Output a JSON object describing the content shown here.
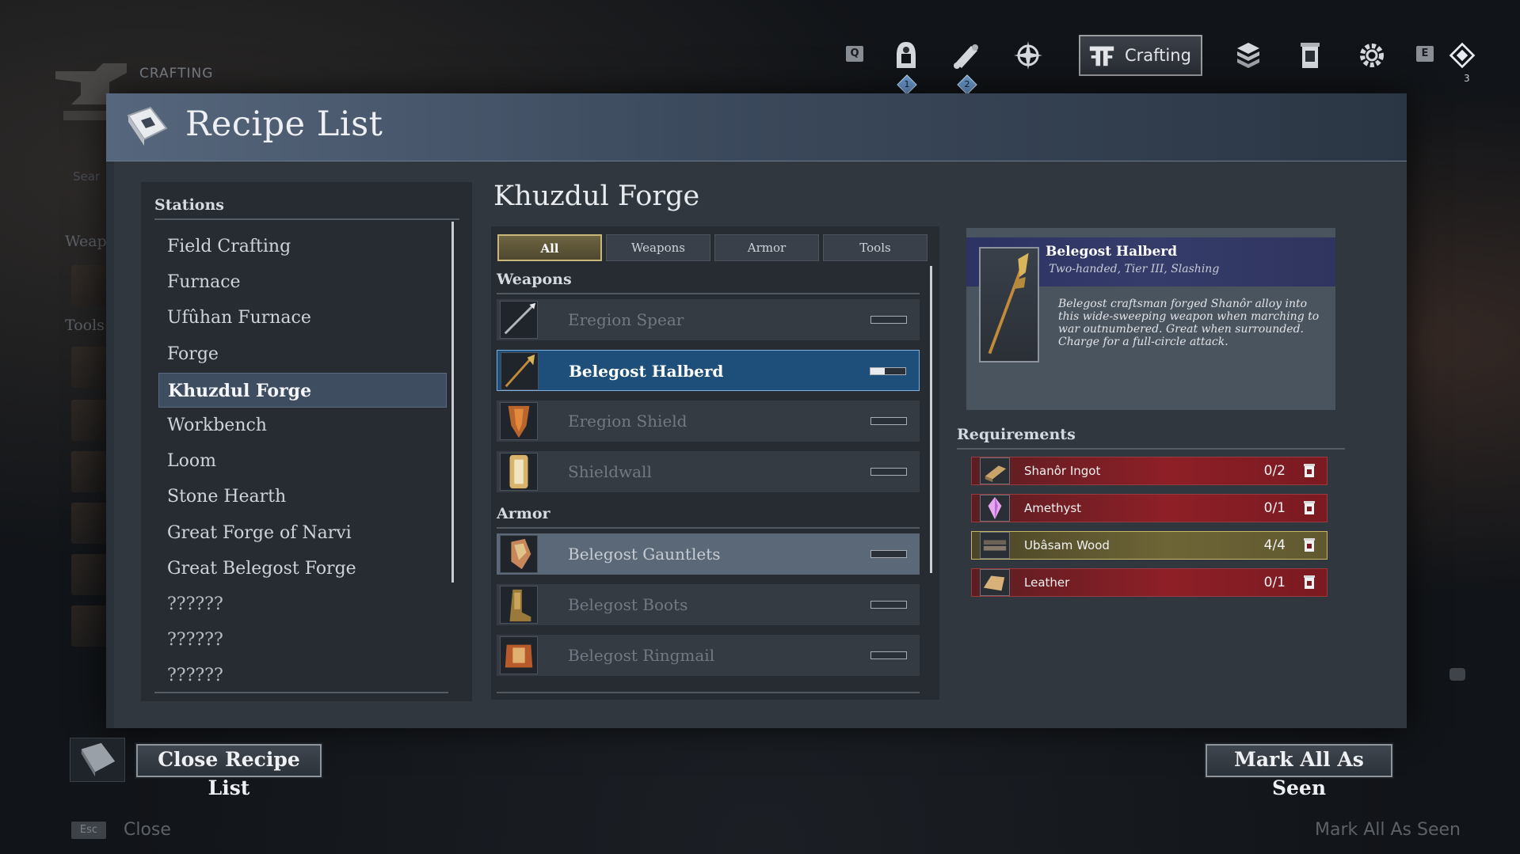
{
  "background": {
    "section_label": "CRAFTING",
    "ghost_list": [
      "Weap",
      "Tools"
    ],
    "ghost_search": "Sear"
  },
  "topbar": {
    "left_key": "Q",
    "right_key": "E",
    "badge_1": "1",
    "badge_2": "2",
    "counter": "3",
    "crafting_label": "Crafting",
    "icons": [
      "character-icon",
      "scroll-icon",
      "compass-icon",
      "crafting-icon",
      "blocks-icon",
      "lantern-icon",
      "gear-icon",
      "waypoint-icon"
    ]
  },
  "panel": {
    "title": "Recipe List"
  },
  "stations": {
    "title": "Stations",
    "items": [
      {
        "label": "Field Crafting",
        "state": "normal"
      },
      {
        "label": "Furnace",
        "state": "normal"
      },
      {
        "label": "Ufûhan Furnace",
        "state": "normal"
      },
      {
        "label": "Forge",
        "state": "normal"
      },
      {
        "label": "Khuzdul Forge",
        "state": "active"
      },
      {
        "label": "Workbench",
        "state": "normal"
      },
      {
        "label": "Loom",
        "state": "normal"
      },
      {
        "label": "Stone Hearth",
        "state": "normal"
      },
      {
        "label": "Great Forge of Narvi",
        "state": "normal"
      },
      {
        "label": "Great Belegost Forge",
        "state": "normal"
      },
      {
        "label": "??????",
        "state": "locked"
      },
      {
        "label": "??????",
        "state": "locked"
      },
      {
        "label": "??????",
        "state": "locked"
      }
    ]
  },
  "recipes": {
    "station_title": "Khuzdul Forge",
    "tabs": [
      {
        "label": "All",
        "active": true
      },
      {
        "label": "Weapons",
        "active": false
      },
      {
        "label": "Armor",
        "active": false
      },
      {
        "label": "Tools",
        "active": false
      }
    ],
    "sections": [
      {
        "title": "Weapons",
        "items": [
          {
            "name": "Eregion Spear",
            "state": "normal",
            "progress": 0.0
          },
          {
            "name": "Belegost Halberd",
            "state": "selected",
            "progress": 0.4
          },
          {
            "name": "Eregion Shield",
            "state": "normal",
            "progress": 0.0
          },
          {
            "name": "Shieldwall",
            "state": "normal",
            "progress": 0.0
          }
        ]
      },
      {
        "title": "Armor",
        "items": [
          {
            "name": "Belegost Gauntlets",
            "state": "hover",
            "progress": 0.0
          },
          {
            "name": "Belegost Boots",
            "state": "normal",
            "progress": 0.0
          },
          {
            "name": "Belegost Ringmail",
            "state": "normal",
            "progress": 0.0
          }
        ]
      }
    ]
  },
  "detail": {
    "name": "Belegost Halberd",
    "subtitle": "Two-handed, Tier III, Slashing",
    "description": "Belegost craftsman forged Shanôr alloy into this wide-sweeping weapon when marching to war outnumbered. Great when surrounded. Charge for a full-circle attack."
  },
  "requirements": {
    "title": "Requirements",
    "items": [
      {
        "name": "Shanôr Ingot",
        "count": "0/2",
        "met": false
      },
      {
        "name": "Amethyst",
        "count": "0/1",
        "met": false
      },
      {
        "name": "Ubâsam Wood",
        "count": "4/4",
        "met": true
      },
      {
        "name": "Leather",
        "count": "0/1",
        "met": false
      }
    ]
  },
  "footer": {
    "close_button": "Close Recipe List",
    "mark_button": "Mark All As Seen",
    "esc_key": "Esc",
    "ghost_close": "Close",
    "ghost_mark": "Mark All As Seen"
  },
  "colors": {
    "accent_blue": "#1d4f7a",
    "requirement_missing": "#8e1f27",
    "requirement_met": "#6e6536"
  }
}
